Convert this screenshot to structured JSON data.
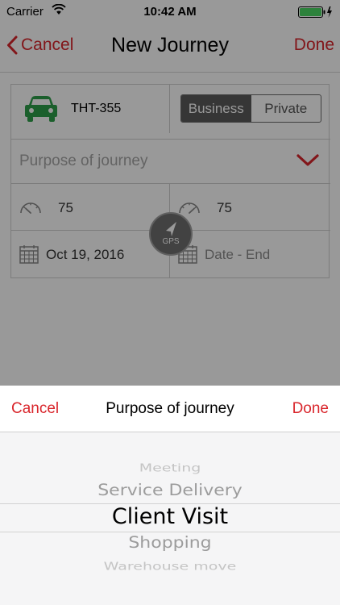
{
  "status_bar": {
    "carrier": "Carrier",
    "time": "10:42 AM",
    "battery_color": "#4cd964"
  },
  "nav": {
    "cancel": "Cancel",
    "title": "New Journey",
    "done": "Done",
    "accent": "#d9262c"
  },
  "vehicle": {
    "plate": "THT-355",
    "icon": "car-icon",
    "icon_color": "#2e9e4a"
  },
  "trip_type": {
    "options": [
      "Business",
      "Private"
    ],
    "selected": "Business"
  },
  "purpose": {
    "placeholder": "Purpose of journey"
  },
  "odometer": {
    "start": "75",
    "end": "75"
  },
  "dates": {
    "start": "Oct 19, 2016",
    "end_placeholder": "Date - End"
  },
  "gps": {
    "label": "GPS"
  },
  "picker": {
    "cancel": "Cancel",
    "title": "Purpose of journey",
    "done": "Done",
    "options": [
      "Meeting",
      "Service Delivery",
      "Client Visit",
      "Shopping",
      "Warehouse move"
    ],
    "selected": "Client Visit"
  }
}
